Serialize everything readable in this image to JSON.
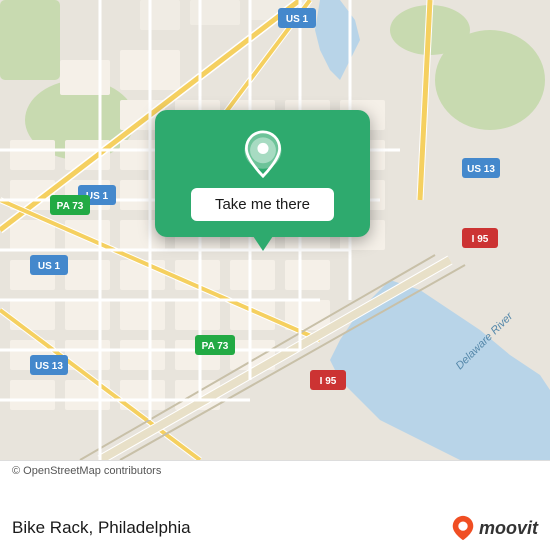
{
  "map": {
    "attribution": "© OpenStreetMap contributors",
    "background_color": "#e8e4dc"
  },
  "popup": {
    "button_label": "Take me there",
    "pin_color": "#2eaa6e"
  },
  "bottom_bar": {
    "location_name": "Bike Rack, Philadelphia",
    "moovit_label": "moovit"
  },
  "road_labels": {
    "us1_top": "US 1",
    "us1_left": "US 1",
    "us1_bottom": "US 1",
    "us13_right": "US 13",
    "us13_left": "US 13",
    "pa73_left": "PA 73",
    "pa73_bottom": "PA 73",
    "i95_right": "I 95",
    "i95_bottom": "I 95",
    "delaware_river": "Delaware River"
  }
}
